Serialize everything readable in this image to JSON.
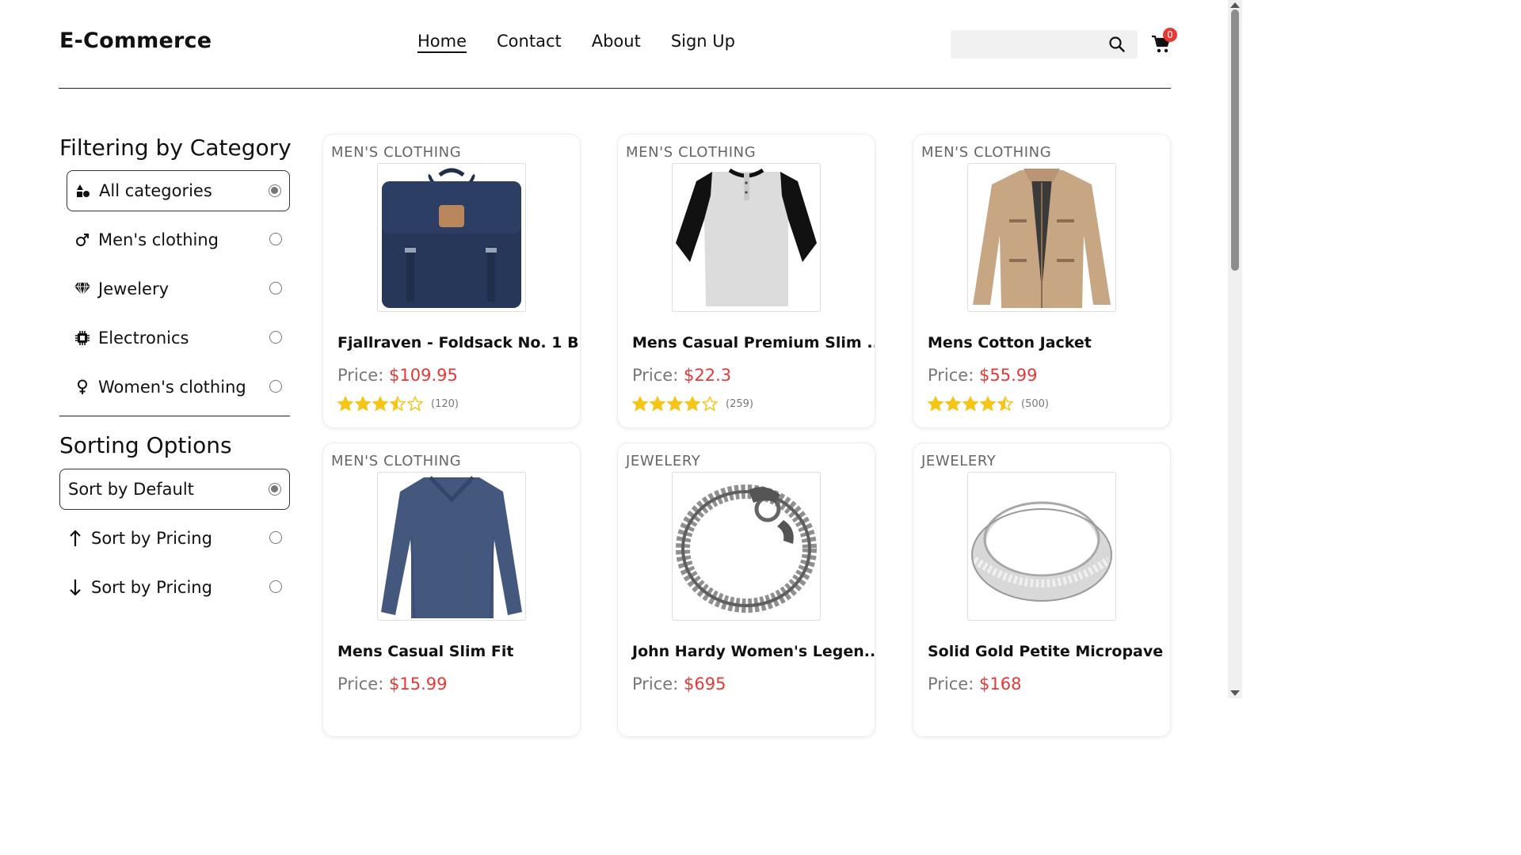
{
  "header": {
    "brand": "E-Commerce",
    "nav": [
      "Home",
      "Contact",
      "About",
      "Sign Up"
    ],
    "search_placeholder": "",
    "cart_count": "0"
  },
  "sidebar": {
    "filter_title": "Filtering by Category",
    "categories": [
      {
        "label": "All categories",
        "icon": "shapes-icon",
        "selected": true
      },
      {
        "label": "Men's clothing",
        "icon": "male-icon",
        "selected": false
      },
      {
        "label": "Jewelery",
        "icon": "gem-icon",
        "selected": false
      },
      {
        "label": "Electronics",
        "icon": "chip-icon",
        "selected": false
      },
      {
        "label": "Women's clothing",
        "icon": "female-icon",
        "selected": false
      }
    ],
    "sort_title": "Sorting Options",
    "sorts": [
      {
        "label": "Sort by Default",
        "icon": "",
        "selected": true
      },
      {
        "label": "Sort by Pricing",
        "icon": "arrow-up-icon",
        "selected": false
      },
      {
        "label": "Sort by Pricing",
        "icon": "arrow-down-icon",
        "selected": false
      }
    ]
  },
  "products": [
    {
      "category": "MEN'S CLOTHING",
      "title": "Fjallraven - Foldsack No. 1 B...",
      "price_label": "Price:",
      "price": "$109.95",
      "rating": 3.5,
      "count": "(120)",
      "image": "backpack"
    },
    {
      "category": "MEN'S CLOTHING",
      "title": "Mens Casual Premium Slim ...",
      "price_label": "Price:",
      "price": "$22.3",
      "rating": 4.0,
      "count": "(259)",
      "image": "tshirt"
    },
    {
      "category": "MEN'S CLOTHING",
      "title": "Mens Cotton Jacket",
      "price_label": "Price:",
      "price": "$55.99",
      "rating": 4.5,
      "count": "(500)",
      "image": "jacket"
    },
    {
      "category": "MEN'S CLOTHING",
      "title": "Mens Casual Slim Fit",
      "price_label": "Price:",
      "price": "$15.99",
      "rating": null,
      "count": "",
      "image": "longsleeve"
    },
    {
      "category": "JEWELERY",
      "title": "John Hardy Women's Legen...",
      "price_label": "Price:",
      "price": "$695",
      "rating": null,
      "count": "",
      "image": "bracelet"
    },
    {
      "category": "JEWELERY",
      "title": "Solid Gold Petite Micropave",
      "price_label": "Price:",
      "price": "$168",
      "rating": null,
      "count": "",
      "image": "ring"
    }
  ],
  "colors": {
    "price": "#e53935",
    "star": "#f5c518",
    "badge": "#e53935"
  }
}
